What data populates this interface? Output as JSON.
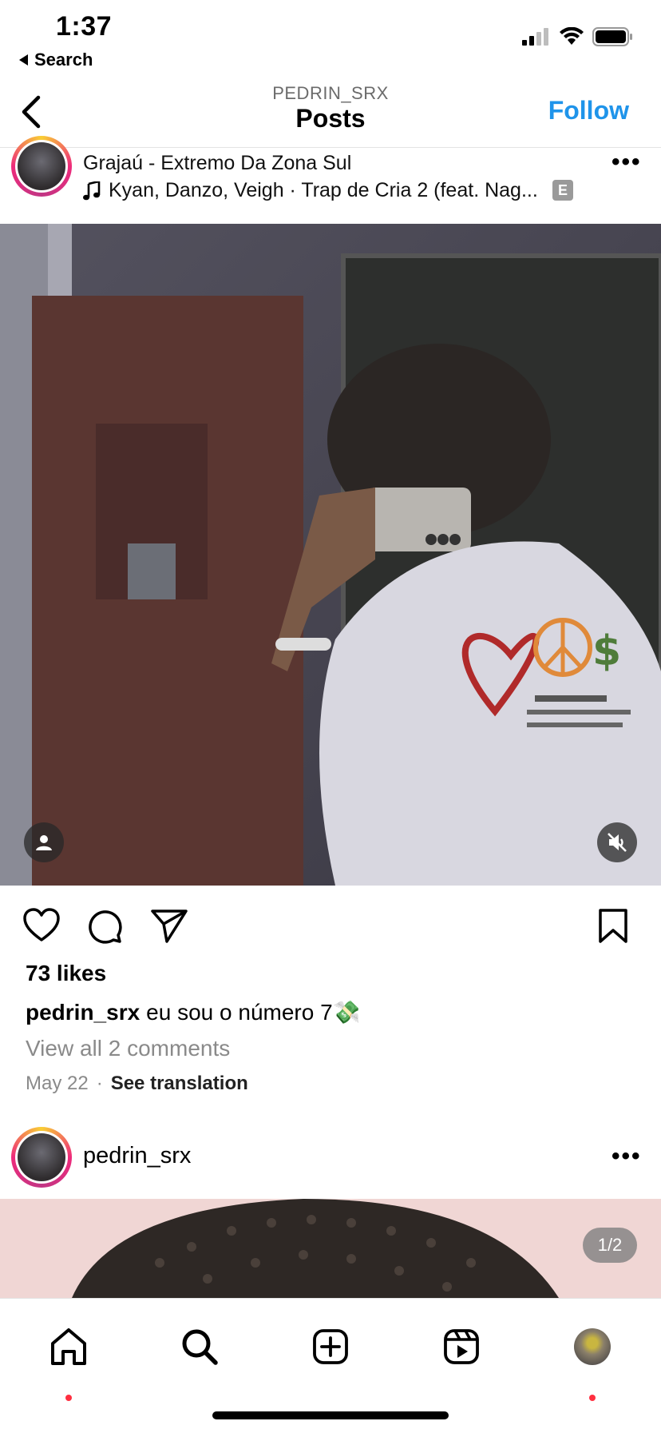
{
  "status_bar": {
    "time": "1:37",
    "back_label": "Search"
  },
  "header": {
    "username": "PEDRIN_SRX",
    "title": "Posts",
    "follow_label": "Follow"
  },
  "post1": {
    "location": "Grajaú - Extremo Da Zona Sul",
    "music": "Kyan, Danzo, Veigh · Trap de Cria 2 (feat. Nag...",
    "explicit_badge": "E",
    "likes": "73 likes",
    "caption_user": "pedrin_srx",
    "caption_text": "eu sou o número 7💸",
    "view_comments": "View all 2 comments",
    "date": "May 22",
    "separator": "·",
    "see_translation": "See translation"
  },
  "post2": {
    "username": "pedrin_srx",
    "carousel_count": "1/2"
  },
  "icons": {
    "more": "more-dots-icon",
    "like": "heart-icon",
    "comment": "comment-icon",
    "share": "send-icon",
    "save": "bookmark-icon",
    "tag": "person-tag-icon",
    "mute": "muted-speaker-icon",
    "music": "music-note-icon"
  },
  "colors": {
    "accent": "#1f94ea",
    "notification_dot": "#ff2f40"
  }
}
